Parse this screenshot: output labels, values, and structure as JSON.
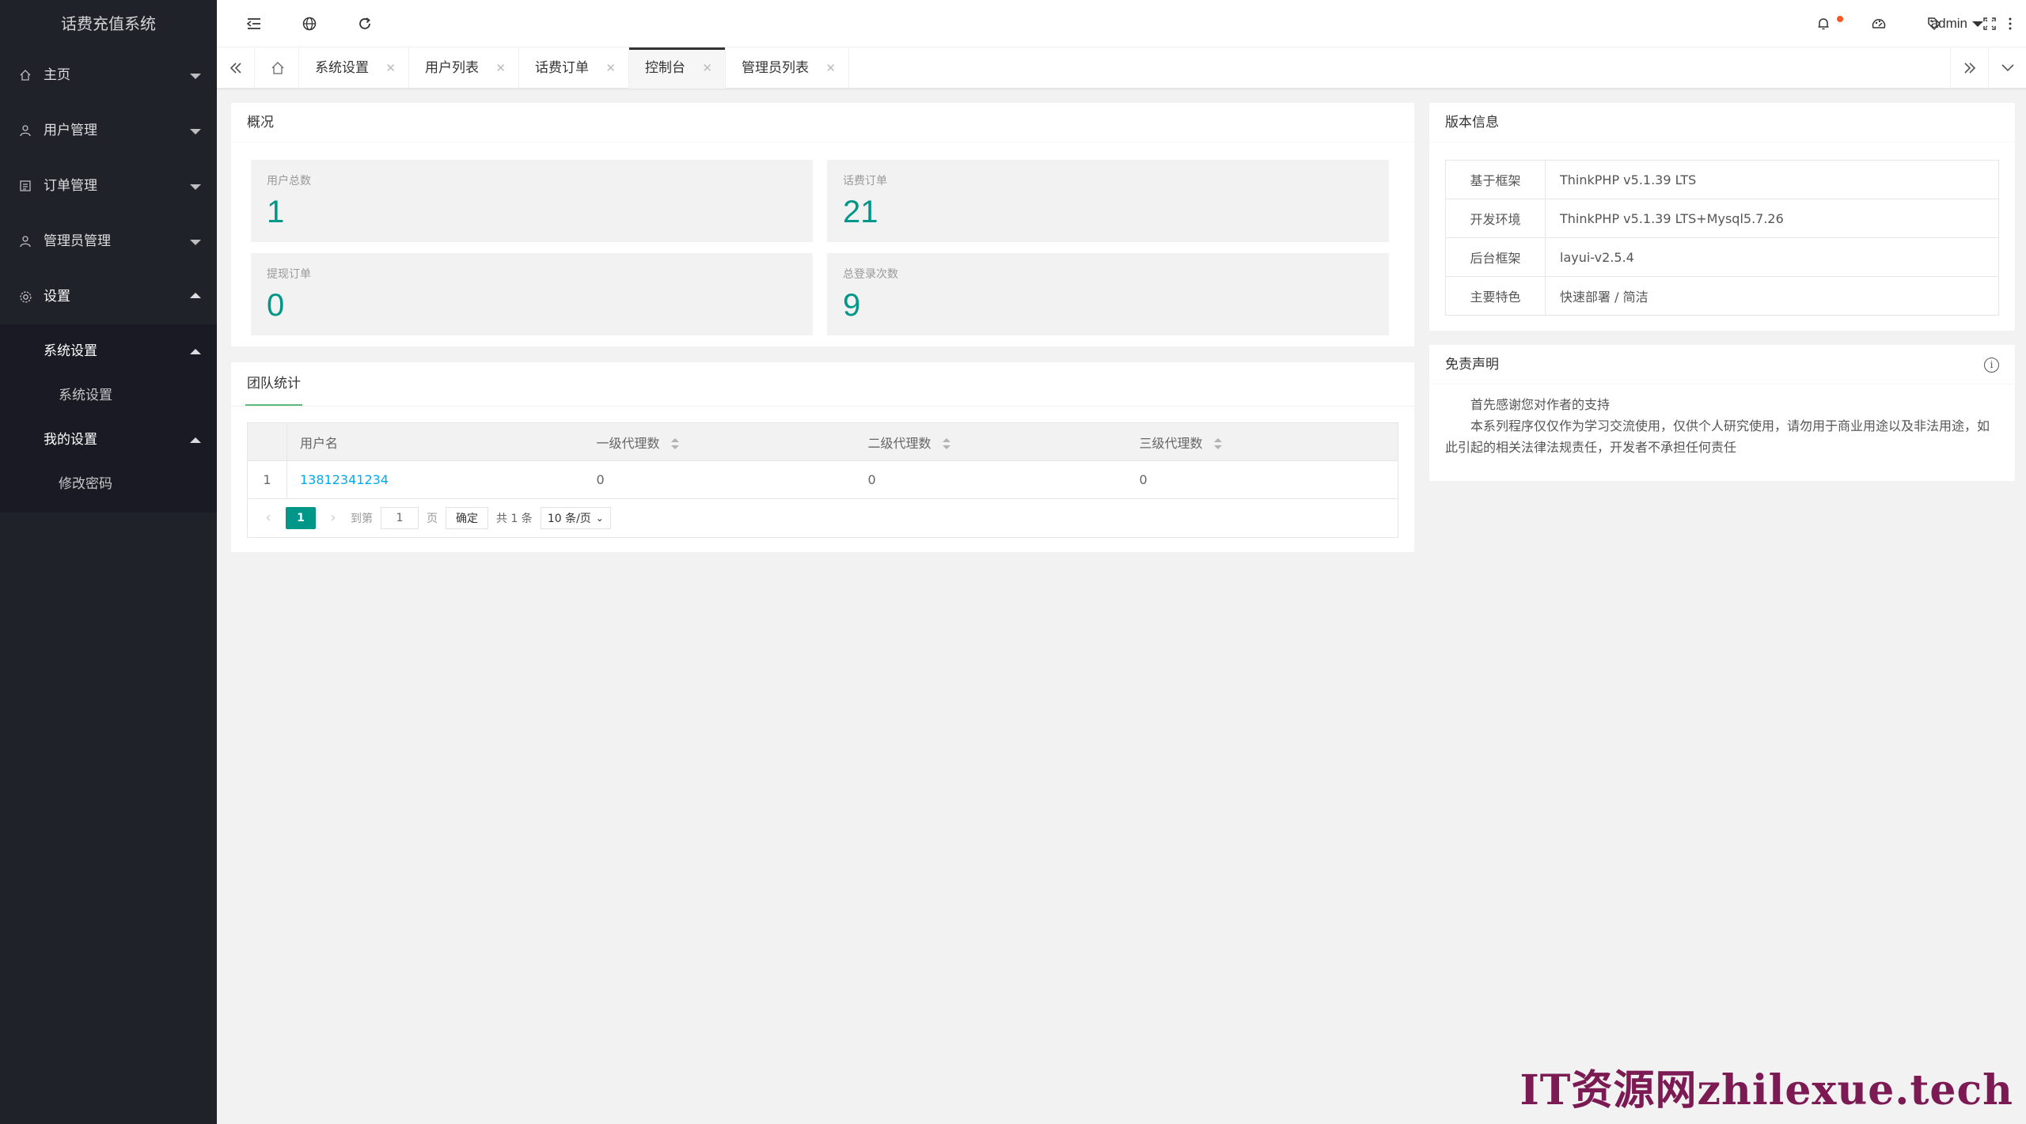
{
  "app": {
    "title": "话费充值系统"
  },
  "sidebar": {
    "items": [
      {
        "label": "主页",
        "icon": "home-icon"
      },
      {
        "label": "用户管理",
        "icon": "user-icon"
      },
      {
        "label": "订单管理",
        "icon": "order-icon"
      },
      {
        "label": "管理员管理",
        "icon": "admin-icon"
      },
      {
        "label": "设置",
        "icon": "gear-icon",
        "expanded": true
      }
    ],
    "settings_sub": {
      "system_head": "系统设置",
      "system_leaf": "系统设置",
      "my_head": "我的设置",
      "my_leaf": "修改密码"
    }
  },
  "header": {
    "user": "admin",
    "icons": [
      "menu-toggle-icon",
      "globe-icon",
      "refresh-icon",
      "bell-icon",
      "theme-icon",
      "tag-icon",
      "fullscreen-icon",
      "more-icon"
    ],
    "notification_color": "#ff5722"
  },
  "tabs": {
    "items": [
      {
        "label": "系统设置"
      },
      {
        "label": "用户列表"
      },
      {
        "label": "话费订单"
      },
      {
        "label": "控制台",
        "active": true
      },
      {
        "label": "管理员列表"
      }
    ]
  },
  "overview": {
    "title": "概况",
    "stats": [
      {
        "label": "用户总数",
        "value": "1"
      },
      {
        "label": "话费订单",
        "value": "21"
      },
      {
        "label": "提现订单",
        "value": "0"
      },
      {
        "label": "总登录次数",
        "value": "9"
      }
    ],
    "accent": "#009688"
  },
  "version": {
    "title": "版本信息",
    "rows": [
      {
        "k": "基于框架",
        "v": "ThinkPHP v5.1.39 LTS"
      },
      {
        "k": "开发环境",
        "v": "ThinkPHP v5.1.39 LTS+Mysql5.7.26"
      },
      {
        "k": "后台框架",
        "v": "layui-v2.5.4"
      },
      {
        "k": "主要特色",
        "v": "快速部署 / 简洁"
      }
    ]
  },
  "team": {
    "tab": "团队统计",
    "columns": [
      "用户名",
      "一级代理数",
      "二级代理数",
      "三级代理数"
    ],
    "rows": [
      {
        "idx": "1",
        "username": "13812341234",
        "l1": "0",
        "l2": "0",
        "l3": "0"
      }
    ],
    "pager": {
      "current": "1",
      "goto": "到第",
      "page_input": "1",
      "page_unit": "页",
      "confirm": "确定",
      "total": "共 1 条",
      "per_page": "10 条/页"
    }
  },
  "disclaimer": {
    "title": "免责声明",
    "p1": "首先感谢您对作者的支持",
    "p2": "本系列程序仅仅作为学习交流使用，仅供个人研究使用，请勿用于商业用途以及非法用途，如此引起的相关法律法规责任，开发者不承担任何责任"
  },
  "watermark": "IT资源网zhilexue.tech"
}
